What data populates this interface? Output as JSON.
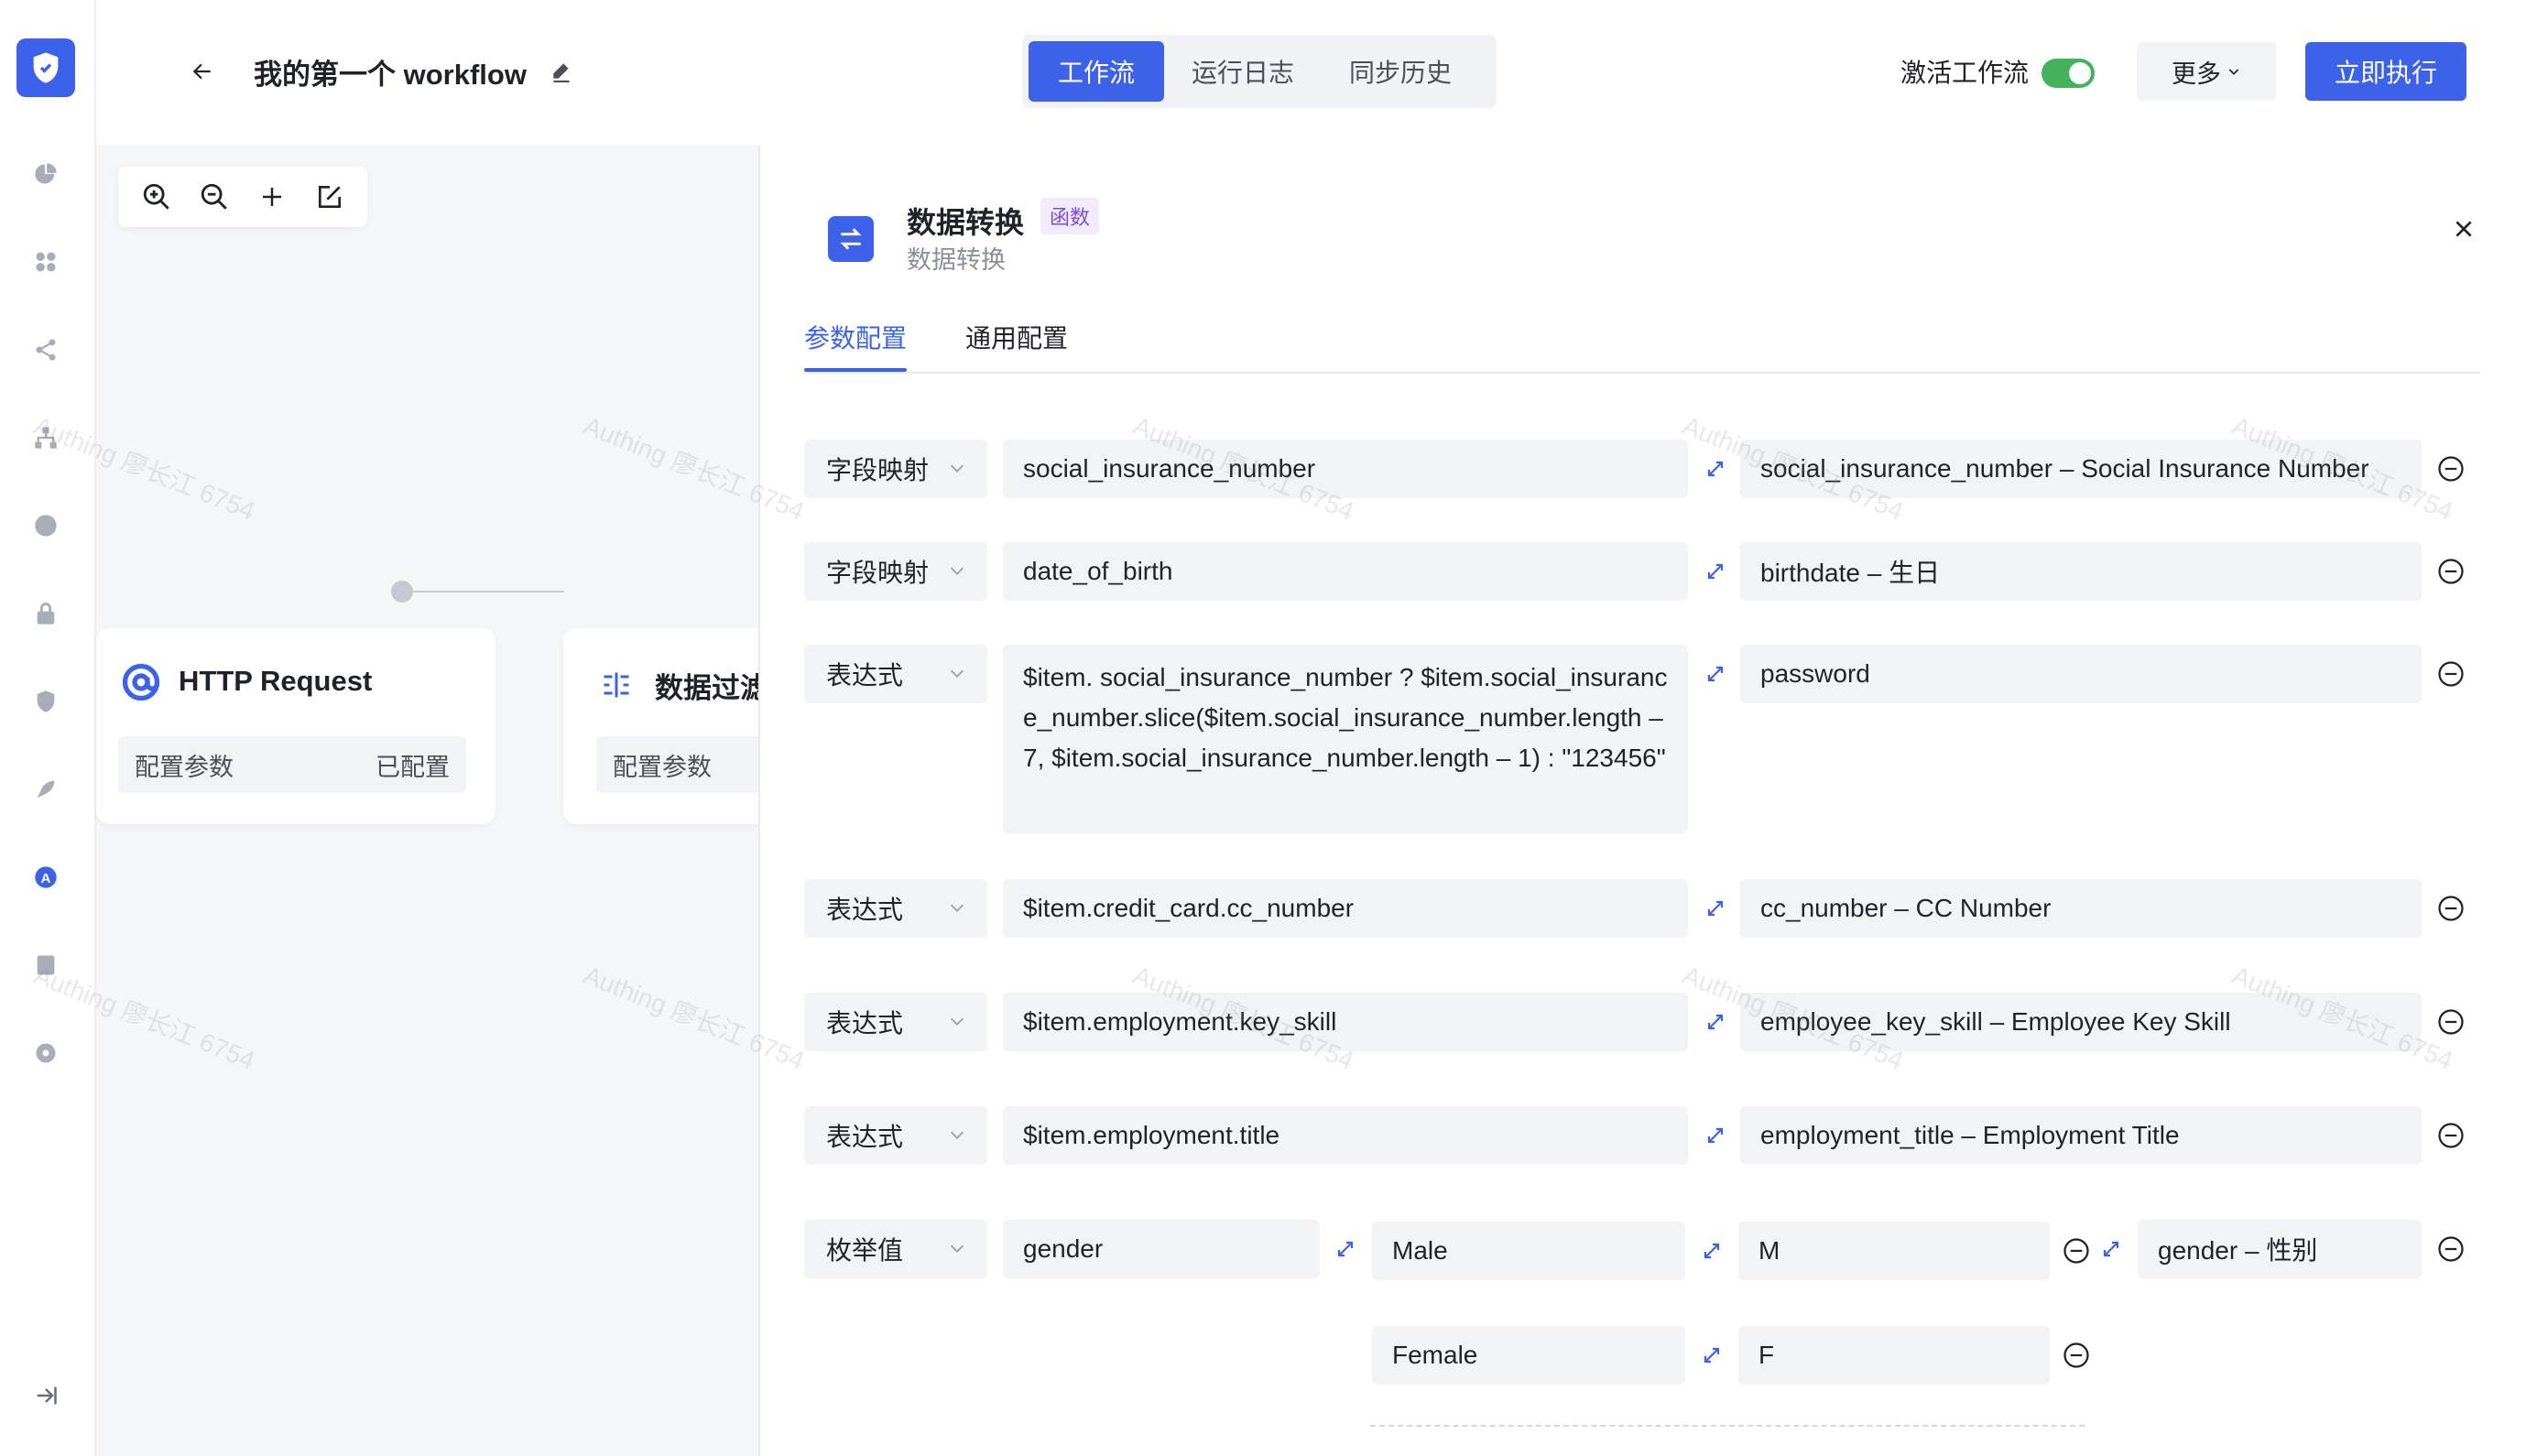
{
  "header": {
    "title": "我的第一个 workflow",
    "tabs": [
      "工作流",
      "运行日志",
      "同步历史"
    ],
    "activate_label": "激活工作流",
    "activate_on": true,
    "more_label": "更多",
    "run_label": "立即执行"
  },
  "sidebar": {
    "icons": [
      "chart-pie-icon",
      "apps-icon",
      "share-icon",
      "org-icon",
      "palette-icon",
      "lock-icon",
      "shield-icon",
      "rocket-icon",
      "a-badge-icon",
      "document-icon",
      "settings-icon"
    ],
    "collapse_icon": "collapse-icon"
  },
  "canvas": {
    "nodes": [
      {
        "title": "HTTP Request",
        "row_label": "配置参数",
        "row_status": "已配置"
      },
      {
        "title": "数据过滤",
        "row_label": "配置参数",
        "row_status": ""
      }
    ]
  },
  "panel": {
    "title": "数据转换",
    "badge": "函数",
    "subtitle": "数据转换",
    "tabs": [
      "参数配置",
      "通用配置"
    ],
    "rows": [
      {
        "type": "字段映射",
        "source": "social_insurance_number",
        "target": "social_insurance_number – Social Insurance Number"
      },
      {
        "type": "字段映射",
        "source": "date_of_birth",
        "target": "birthdate – 生日"
      },
      {
        "type": "表达式",
        "source": "$item. social_insurance_number ? $item.social_insurance_number.slice($item.social_insurance_number.length – 7, $item.social_insurance_number.length – 1) : \"123456\"",
        "target": "password"
      },
      {
        "type": "表达式",
        "source": "$item.credit_card.cc_number",
        "target": "cc_number – CC Number"
      },
      {
        "type": "表达式",
        "source": "$item.employment.key_skill",
        "target": "employee_key_skill – Employee Key Skill"
      },
      {
        "type": "表达式",
        "source": "$item.employment.title",
        "target": "employment_title – Employment Title"
      }
    ],
    "enum_row": {
      "type": "枚举值",
      "source": "gender",
      "target": "gender – 性别",
      "pairs": [
        {
          "from": "Male",
          "to": "M"
        },
        {
          "from": "Female",
          "to": "F"
        }
      ]
    }
  },
  "watermark": "Authing 廖长江 6754",
  "colors": {
    "accent": "#3d62ea",
    "toggle": "#42b35c",
    "badge_text": "#7a4ce0",
    "badge_bg": "#f3ecfd"
  }
}
